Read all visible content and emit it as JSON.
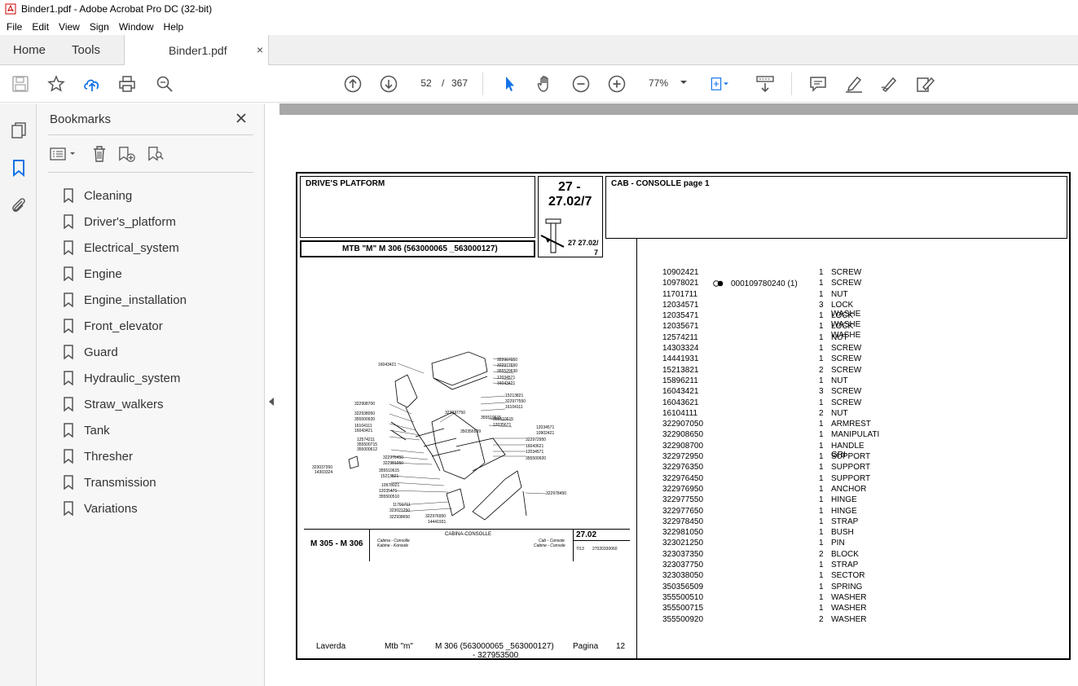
{
  "window": {
    "title": "Binder1.pdf - Adobe Acrobat Pro DC (32-bit)"
  },
  "menu": [
    "File",
    "Edit",
    "View",
    "Sign",
    "Window",
    "Help"
  ],
  "tabs": {
    "home": "Home",
    "tools": "Tools",
    "document": "Binder1.pdf",
    "close": "×"
  },
  "toolbar": {
    "page_current": "52",
    "page_separator": "/",
    "page_total": "367",
    "zoom": "77%",
    "icons": [
      "save-icon",
      "star-icon",
      "upload-cloud-icon",
      "print-icon",
      "zoom-search-icon",
      "page-up-icon",
      "page-down-icon",
      "select-pointer-icon",
      "hand-icon",
      "zoom-out-icon",
      "zoom-in-icon",
      "fit-page-icon",
      "scroll-mode-icon",
      "comment-icon",
      "highlight-icon",
      "sign-icon",
      "fill-sign-icon"
    ]
  },
  "bookmarks": {
    "title": "Bookmarks",
    "items": [
      "Cleaning",
      "Driver's_platform",
      "Electrical_system",
      "Engine",
      "Engine_installation",
      "Front_elevator",
      "Guard",
      "Hydraulic_system",
      "Straw_walkers",
      "Tank",
      "Thresher",
      "Transmission",
      "Variations"
    ]
  },
  "document": {
    "section_title": "DRIVE'S PLATFORM",
    "group_code_line1": "27 -",
    "group_code_line2": "27.02/7",
    "page_title": "CAB - CONSOLLE  page 1",
    "model_line": "MTB \"M\" M 306 (563000065 _563000127)",
    "ref_small": "27 27.02/",
    "ref_small2": "7",
    "footer_model": "M 305 - M 306",
    "footer_caption_center": "CABINA-CONSOLLE",
    "footer_caption_it": "Cabina - Consolle",
    "footer_caption_de": "Kabine - Konsole",
    "footer_caption_en": "Cab - Console",
    "footer_caption_fr": "Cabine - Console",
    "footer_code": "27.02",
    "footer_page": "7/13",
    "footer_drawing": "27020330060",
    "bottom_brand": "Laverda",
    "bottom_series": "Mtb \"m\"",
    "bottom_model": "M 306 (563000065 _563000127)",
    "bottom_serial": "- 327953500",
    "bottom_pagina": "Pagina",
    "bottom_page": "12",
    "variant_note": "000109780240  (1)",
    "diagram_labels": [
      "16043421",
      "322907050",
      "322977650",
      "355520630",
      "12034571",
      "16043421",
      "15213821",
      "322977550",
      "16104111",
      "322908700",
      "322937750",
      "355510615",
      "322938050",
      "355500920",
      "12035671",
      "16104111",
      "12034571",
      "10902421",
      "16043421",
      "355510615",
      "12574211",
      "322972950",
      "355500715",
      "350356509",
      "16043621",
      "355000612",
      "12034571",
      "322976450",
      "355500920",
      "322981050",
      "323037350",
      "355510615",
      "14303324",
      "15213821",
      "10978021",
      "12035471",
      "355500510",
      "322978450",
      "11701711",
      "323021250",
      "322938650",
      "322976950",
      "14441931"
    ],
    "parts": [
      {
        "code": "10902421",
        "qty": "1",
        "desc": "SCREW"
      },
      {
        "code": "10978021",
        "qty": "1",
        "desc": "SCREW"
      },
      {
        "code": "11701711",
        "qty": "1",
        "desc": "NUT"
      },
      {
        "code": "12034571",
        "qty": "3",
        "desc": "LOCK WASHE"
      },
      {
        "code": "12035471",
        "qty": "1",
        "desc": "LOCK WASHE"
      },
      {
        "code": "12035671",
        "qty": "1",
        "desc": "LOCK WASHE"
      },
      {
        "code": "12574211",
        "qty": "1",
        "desc": "NUT"
      },
      {
        "code": "14303324",
        "qty": "1",
        "desc": "SCREW"
      },
      {
        "code": "14441931",
        "qty": "1",
        "desc": "SCREW"
      },
      {
        "code": "15213821",
        "qty": "2",
        "desc": "SCREW"
      },
      {
        "code": "15896211",
        "qty": "1",
        "desc": "NUT"
      },
      {
        "code": "16043421",
        "qty": "3",
        "desc": "SCREW"
      },
      {
        "code": "16043621",
        "qty": "1",
        "desc": "SCREW"
      },
      {
        "code": "16104111",
        "qty": "2",
        "desc": "NUT"
      },
      {
        "code": "322907050",
        "qty": "1",
        "desc": "ARMREST"
      },
      {
        "code": "322908650",
        "qty": "1",
        "desc": "MANIPULATI"
      },
      {
        "code": "322908700",
        "qty": "1",
        "desc": "HANDLE GRI"
      },
      {
        "code": "322972950",
        "qty": "1",
        "desc": "SUPPORT"
      },
      {
        "code": "322976350",
        "qty": "1",
        "desc": "SUPPORT"
      },
      {
        "code": "322976450",
        "qty": "1",
        "desc": "SUPPORT"
      },
      {
        "code": "322976950",
        "qty": "1",
        "desc": "ANCHOR"
      },
      {
        "code": "322977550",
        "qty": "1",
        "desc": "HINGE"
      },
      {
        "code": "322977650",
        "qty": "1",
        "desc": "HINGE"
      },
      {
        "code": "322978450",
        "qty": "1",
        "desc": "STRAP"
      },
      {
        "code": "322981050",
        "qty": "1",
        "desc": "BUSH"
      },
      {
        "code": "323021250",
        "qty": "1",
        "desc": "PIN"
      },
      {
        "code": "323037350",
        "qty": "2",
        "desc": "BLOCK"
      },
      {
        "code": "323037750",
        "qty": "1",
        "desc": "STRAP"
      },
      {
        "code": "323038050",
        "qty": "1",
        "desc": "SECTOR"
      },
      {
        "code": "350356509",
        "qty": "1",
        "desc": "SPRING"
      },
      {
        "code": "355500510",
        "qty": "1",
        "desc": "WASHER"
      },
      {
        "code": "355500715",
        "qty": "1",
        "desc": "WASHER"
      },
      {
        "code": "355500920",
        "qty": "2",
        "desc": "WASHER"
      }
    ]
  },
  "colors": {
    "accent_blue": "#1473e6",
    "text_gray": "#333333",
    "rail_bg": "#f4f4f4"
  }
}
